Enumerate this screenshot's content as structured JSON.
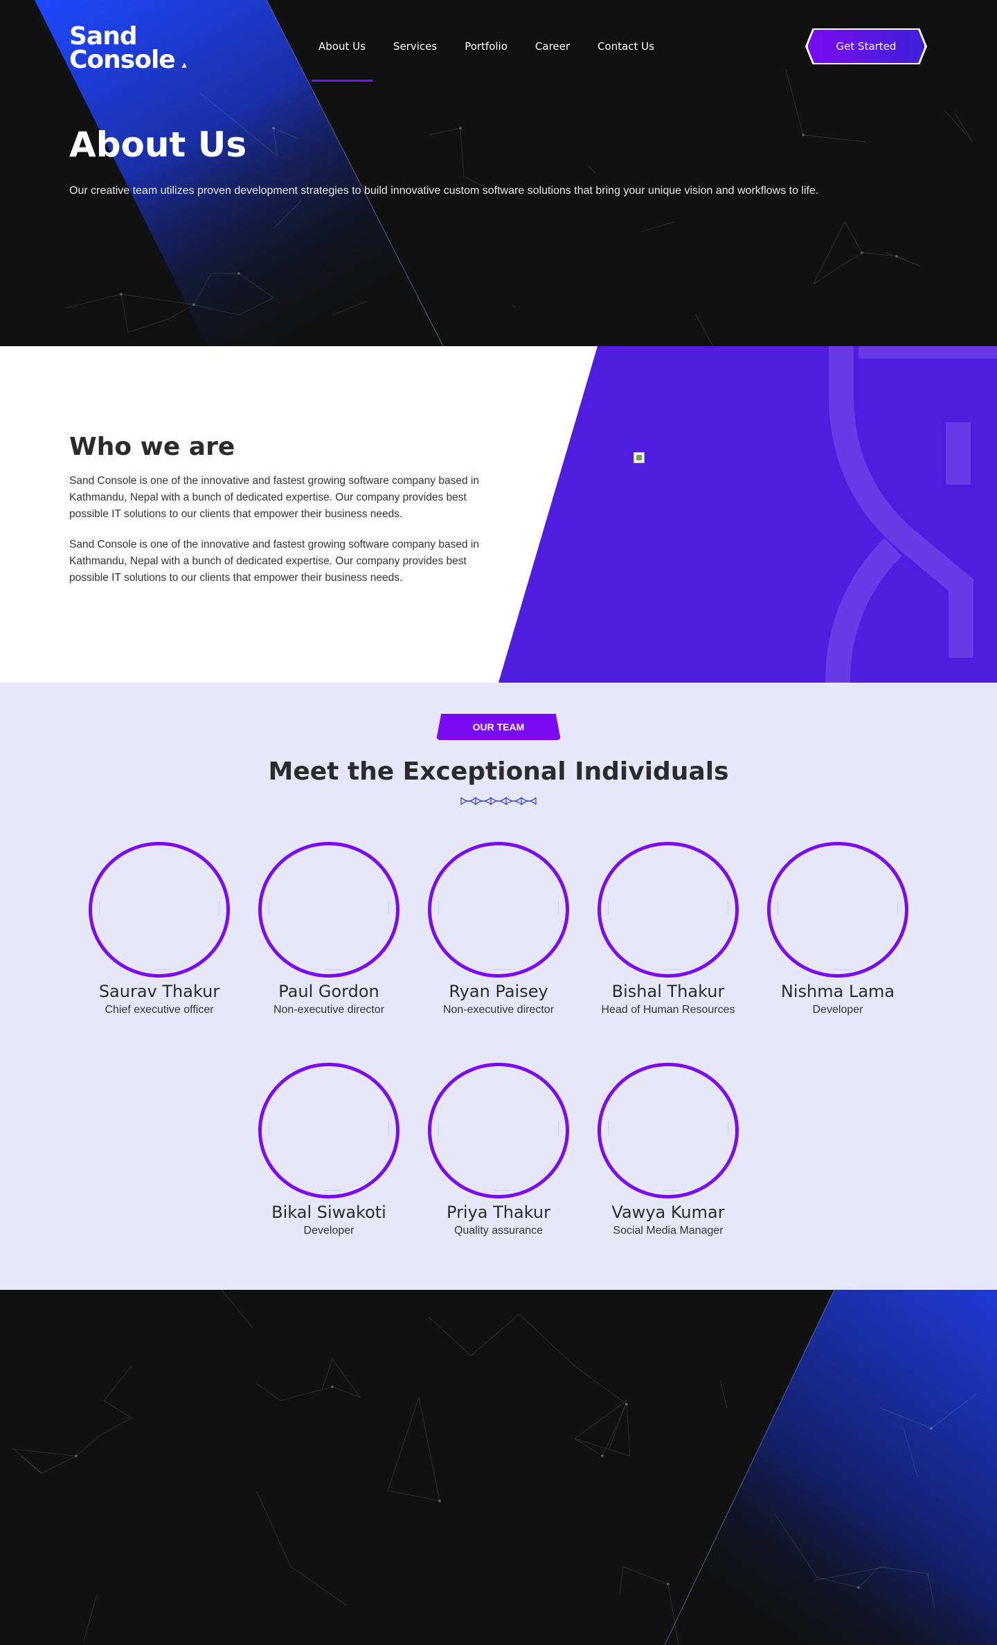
{
  "header": {
    "logo_line1": "Sand",
    "logo_line2": "Console",
    "nav": [
      {
        "label": "About Us",
        "active": true
      },
      {
        "label": "Services"
      },
      {
        "label": "Portfolio"
      },
      {
        "label": "Career"
      },
      {
        "label": "Contact Us"
      }
    ],
    "cta_label": "Get Started"
  },
  "hero": {
    "title": "About Us",
    "description": "Our creative team utilizes proven development strategies to build innovative custom software solutions that bring your unique vision and workflows to life."
  },
  "who": {
    "title": "Who we are",
    "paragraphs": [
      "Sand Console is one of the innovative and fastest growing software company based in Kathmandu, Nepal with a bunch of dedicated expertise. Our company provides best possible IT solutions to our clients that empower their business needs.",
      "Sand Console is one of the innovative and fastest growing software company based in Kathmandu, Nepal with a bunch of dedicated expertise. Our company provides best possible IT solutions to our clients that empower their business needs."
    ]
  },
  "team": {
    "badge": "OUR TEAM",
    "title": "Meet the Exceptional Individuals",
    "members": [
      {
        "name": "Saurav Thakur",
        "role": "Chief executive officer"
      },
      {
        "name": "Paul Gordon",
        "role": "Non-executive director"
      },
      {
        "name": "Ryan Paisey",
        "role": "Non-executive director"
      },
      {
        "name": "Bishal Thakur",
        "role": "Head of Human Resources"
      },
      {
        "name": "Nishma Lama",
        "role": "Developer"
      },
      {
        "name": "Bikal Siwakoti",
        "role": "Developer"
      },
      {
        "name": "Priya Thakur",
        "role": "Quality assurance"
      },
      {
        "name": "Vawya Kumar",
        "role": "Social Media Manager"
      }
    ]
  },
  "colors": {
    "accent_purple": "#7a0bf2",
    "panel_purple": "#501ce0",
    "hero_blue": "#1a46f5",
    "dark_bg": "#111111",
    "team_bg": "#e6e8f9"
  }
}
